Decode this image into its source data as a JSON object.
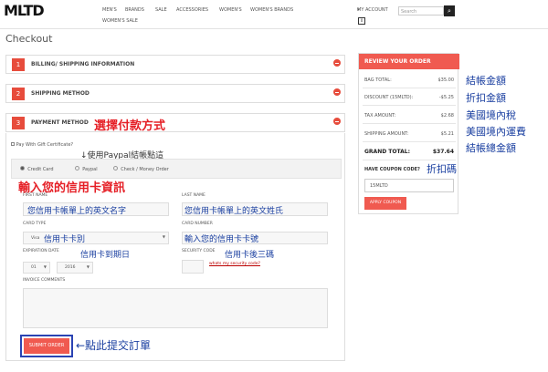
{
  "header": {
    "logo": "MLTD",
    "nav": [
      "MEN'S",
      "BRANDS",
      "SALE",
      "ACCESSORIES",
      "WOMEN'S",
      "WOMEN'S BRANDS",
      "WOMEN'S SALE"
    ],
    "my_account": "MY ACCOUNT",
    "search_placeholder": "Search"
  },
  "page_title": "Checkout",
  "sections": [
    {
      "num": "1",
      "title": "BILLING/ SHIPPING INFORMATION"
    },
    {
      "num": "2",
      "title": "SHIPPING METHOD"
    },
    {
      "num": "3",
      "title": "PAYMENT METHOD"
    }
  ],
  "payment": {
    "gift_label": "Pay With Gift Certificate?",
    "options": [
      "Credit Card",
      "Paypal",
      "Check / Money Order"
    ],
    "first_name_label": "FIRST NAME",
    "last_name_label": "LAST NAME",
    "card_type_label": "CARD TYPE",
    "card_type_value": "Visa",
    "card_number_label": "CARD NUMBER",
    "expiration_label": "EXPIRATION DATE",
    "exp_month": "01",
    "exp_year": "2016",
    "security_label": "SECURITY CODE",
    "security_link": "whats my security code?",
    "invoice_label": "INVOICE COMMENTS",
    "submit": "SUBMIT ORDER"
  },
  "summary": {
    "title": "REVIEW YOUR ORDER",
    "rows": [
      {
        "label": "BAG TOTAL:",
        "value": "$35.00"
      },
      {
        "label": "DISCOUNT (15MLTD):",
        "value": "-$5.25"
      },
      {
        "label": "TAX AMOUNT:",
        "value": "$2.68"
      },
      {
        "label": "SHIPPING AMOUNT:",
        "value": "$5.21"
      }
    ],
    "grand_label": "GRAND TOTAL:",
    "grand_value": "$37.64",
    "coupon_label": "HAVE COUPON CODE?",
    "coupon_value": "15MLTD",
    "apply": "APPLY COUPON"
  },
  "annotations": {
    "payment_method": "選擇付款方式",
    "paypal": "↓使用Paypal結帳點這",
    "credit_info": "輸入您的信用卡資訊",
    "first_name": "您信用卡帳單上的英文名字",
    "last_name": "您信用卡帳單上的英文姓氏",
    "card_type": "信用卡卡別",
    "card_number": "輸入您的信用卡卡號",
    "expiration": "信用卡到期日",
    "security": "信用卡後三碼",
    "submit": "←點此提交訂單",
    "bag_total": "結帳金額",
    "discount": "折扣金額",
    "tax": "美國境內稅",
    "shipping": "美國境內運費",
    "grand_total": "結帳總金額",
    "coupon": "折扣碼"
  }
}
